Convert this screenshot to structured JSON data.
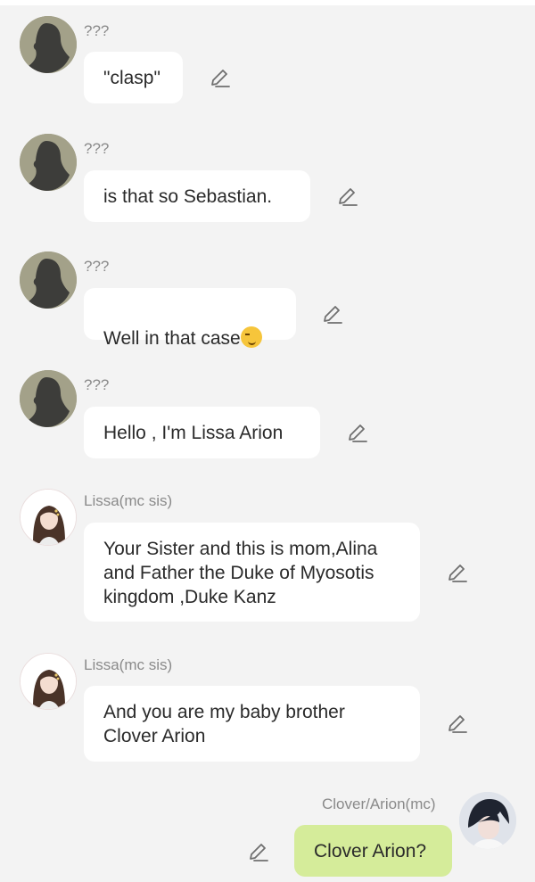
{
  "messages": [
    {
      "sender": "???",
      "text": "\"clasp\"",
      "avatar": "silhouette-avatar"
    },
    {
      "sender": "???",
      "text": "is that so  Sebastian.",
      "avatar": "silhouette-avatar"
    },
    {
      "sender": "???",
      "text": "Well in that case",
      "emoji": "smirk-emoji",
      "avatar": "silhouette-avatar"
    },
    {
      "sender": "???",
      "text": "Hello , I'm Lissa Arion",
      "avatar": "silhouette-avatar"
    },
    {
      "sender": "Lissa(mc sis)",
      "text": "Your Sister and this is mom,Alina\nand Father the Duke of Myosotis\nkingdom ,Duke Kanz",
      "avatar": "girl-avatar"
    },
    {
      "sender": "Lissa(mc sis)",
      "text": "And you are my baby brother\nClover Arion",
      "avatar": "girl-avatar"
    },
    {
      "sender": "Clover/Arion(mc)",
      "text": "Clover Arion?",
      "avatar": "boy-avatar"
    }
  ],
  "icons": {
    "edit": "pencil-icon"
  },
  "colors": {
    "background": "#f3f3f3",
    "bubble": "#ffffff",
    "my_bubble": "#d5ec9a",
    "sender_name": "#8a8a8a"
  }
}
